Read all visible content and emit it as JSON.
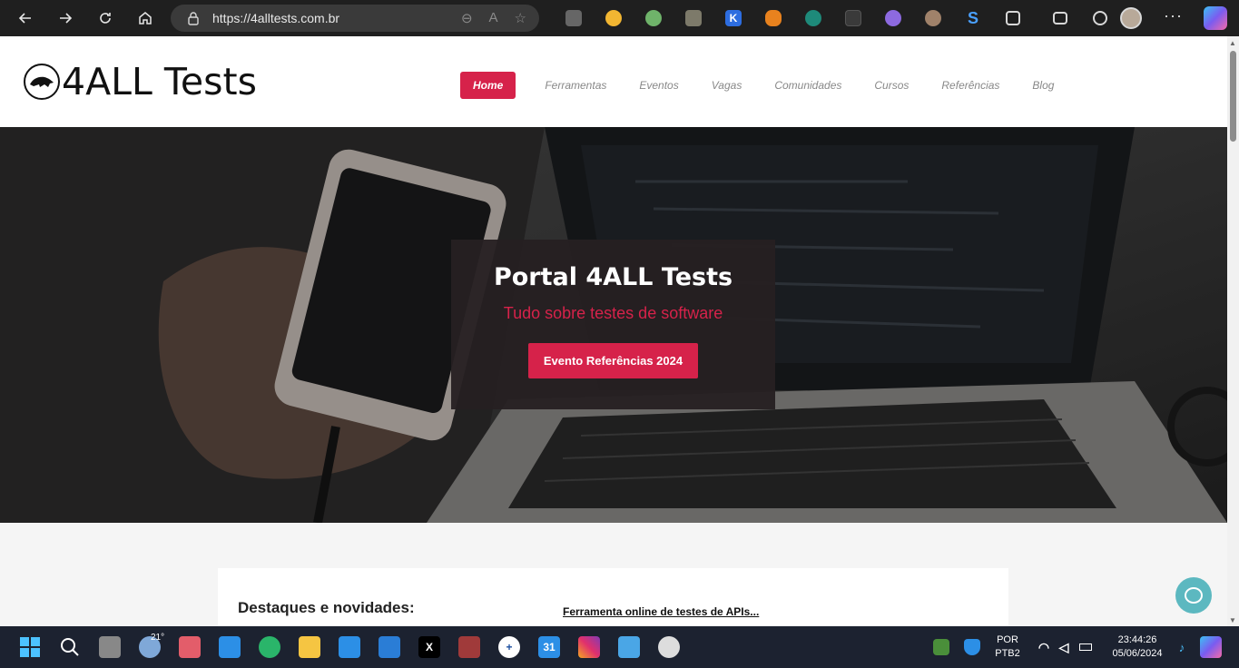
{
  "browser": {
    "url": "https://4alltests.com.br"
  },
  "site": {
    "logo_text": "4ALL Tests",
    "menu": [
      {
        "label": "Home",
        "active": true
      },
      {
        "label": "Ferramentas"
      },
      {
        "label": "Eventos"
      },
      {
        "label": "Vagas"
      },
      {
        "label": "Comunidades"
      },
      {
        "label": "Cursos"
      },
      {
        "label": "Referências"
      },
      {
        "label": "Blog"
      }
    ],
    "accent_color": "#d6224a"
  },
  "hero": {
    "title": "Portal 4ALL Tests",
    "subtitle": "Tudo sobre testes de software",
    "button_label": "Evento Referências 2024"
  },
  "content": {
    "heading": "Destaques e novidades:",
    "link": "Ferramenta online de testes de APIs..."
  },
  "taskbar": {
    "temperature": "21°",
    "language": "POR",
    "keyboard": "PTB2",
    "time": "23:44:26",
    "date": "05/06/2024"
  }
}
